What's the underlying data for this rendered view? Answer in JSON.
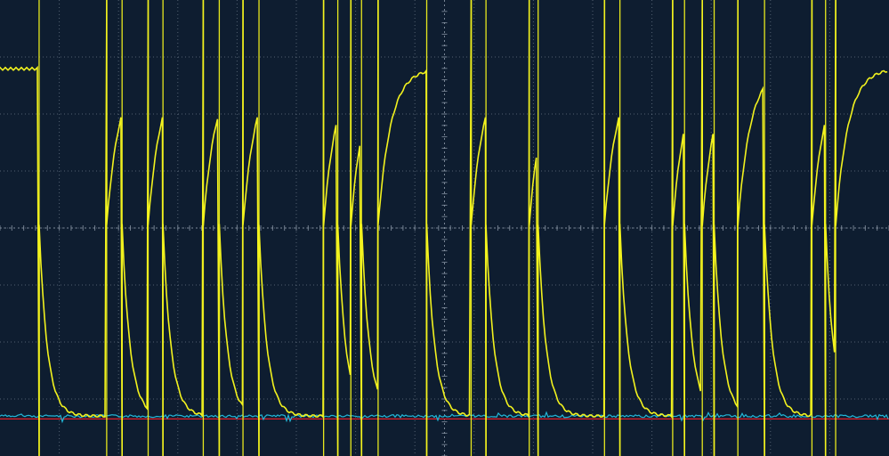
{
  "colors": {
    "background": "#0e1d30",
    "grid": "#8a97a6",
    "signal_yellow": "#f2f21e",
    "signal_cyan": "#22b7d8",
    "reference_red": "#e0202a"
  },
  "chart_data": {
    "type": "line",
    "title": "",
    "xlabel": "",
    "ylabel": "",
    "grid": true,
    "grid_style": "dotted",
    "divisions": {
      "x": 15,
      "y": 8
    },
    "xlim": [
      0,
      15
    ],
    "ylim": [
      -4,
      4
    ],
    "series": [
      {
        "color": "#f2f21e",
        "high_level": 2.8,
        "low_level": -3.3,
        "transitions_div": [
          0.66,
          1.8,
          2.06,
          2.5,
          2.75,
          3.43,
          3.7,
          4.1,
          4.37,
          5.46,
          5.7,
          5.92,
          6.1,
          6.38,
          7.2,
          7.95,
          8.2,
          8.93,
          9.08,
          10.2,
          10.46,
          11.35,
          11.55,
          11.85,
          12.05,
          12.45,
          12.9,
          13.7,
          13.93,
          14.1
        ]
      },
      {
        "color": "#22b7d8",
        "level": -3.3,
        "style": "noisy baseline"
      },
      {
        "color": "#e0202a",
        "level": -3.35,
        "style": "reference"
      }
    ]
  }
}
